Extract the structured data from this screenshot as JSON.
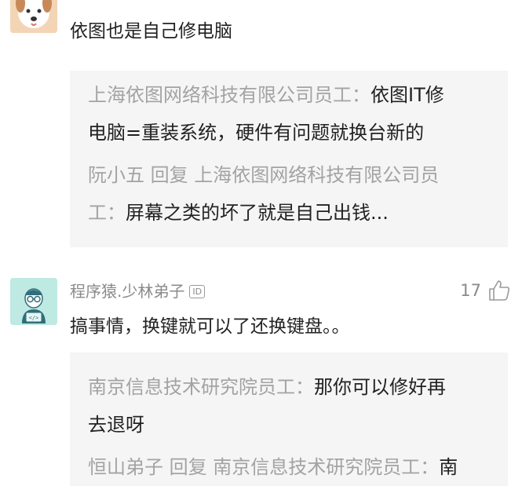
{
  "comments": [
    {
      "text": "依图也是自己修电脑",
      "replies": [
        {
          "lines": [
            [
              {
                "t": "上海依图网络科技有限公司员工",
                "c": "author"
              },
              {
                "t": "：",
                "c": "sep"
              },
              {
                "t": "依图IT修",
                "c": "body"
              }
            ],
            [
              {
                "t": "电脑=重装系统，硬件有问题就换台新的",
                "c": "body"
              }
            ]
          ]
        },
        {
          "lines": [
            [
              {
                "t": "阮小五",
                "c": "author"
              },
              {
                "t": " 回复 ",
                "c": "reply-word"
              },
              {
                "t": "上海依图网络科技有限公司员",
                "c": "author"
              }
            ],
            [
              {
                "t": "工",
                "c": "author"
              },
              {
                "t": "：",
                "c": "sep"
              },
              {
                "t": "屏幕之类的坏了就是自己出钱...",
                "c": "body"
              }
            ]
          ]
        }
      ]
    },
    {
      "username": "程序猿.少林弟子",
      "id_badge": "ID",
      "likes": "17",
      "text": "搞事情，换键就可以了还换键盘。。",
      "replies": [
        {
          "lines": [
            [
              {
                "t": "南京信息技术研究院员工",
                "c": "author"
              },
              {
                "t": "：",
                "c": "sep"
              },
              {
                "t": "那你可以修好再",
                "c": "body"
              }
            ],
            [
              {
                "t": "去退呀",
                "c": "body"
              }
            ]
          ]
        },
        {
          "lines": [
            [
              {
                "t": "恒山弟子",
                "c": "author"
              },
              {
                "t": " 回复 ",
                "c": "reply-word"
              },
              {
                "t": "南京信息技术研究院员工",
                "c": "author"
              },
              {
                "t": "：",
                "c": "sep"
              },
              {
                "t": "南",
                "c": "body"
              }
            ]
          ]
        }
      ]
    }
  ],
  "icons": {
    "avatar1": "dog-avatar-icon",
    "avatar2": "programmer-avatar-icon",
    "like": "thumbs-up-icon"
  },
  "colors": {
    "muted": "#a3a3a3",
    "text": "#222222",
    "reply_bg": "#f5f5f5",
    "avatar2_bg": "#bfe9e3"
  }
}
